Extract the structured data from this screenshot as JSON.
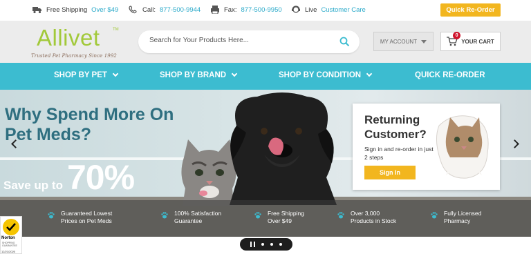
{
  "topbar": {
    "shipping_prefix": "Free Shipping",
    "shipping_value": "Over $49",
    "call_prefix": "Call:",
    "call_value": "877-500-9944",
    "fax_prefix": "Fax:",
    "fax_value": "877-500-9950",
    "live_prefix": "Live",
    "live_value": "Customer Care",
    "reorder_label": "Quick Re-Order"
  },
  "header": {
    "logo_text": "Allivet",
    "logo_tm": "TM",
    "logo_tagline": "Trusted Pet Pharmacy Since 1992",
    "search_placeholder": "Search for Your Products Here...",
    "account_label": "MY ACCOUNT",
    "cart_label": "YOUR CART",
    "cart_count": "0"
  },
  "nav": {
    "items": [
      {
        "label": "SHOP BY PET"
      },
      {
        "label": "SHOP BY BRAND"
      },
      {
        "label": "SHOP BY CONDITION"
      },
      {
        "label": "QUICK RE-ORDER"
      }
    ]
  },
  "hero": {
    "title": "Why Spend More On Pet Meds?",
    "save_label": "Save up to",
    "save_value": "70%",
    "card": {
      "title": "Returning Customer?",
      "subtitle": "Sign in and re-order in just 2 steps",
      "button": "Sign In"
    },
    "features": [
      {
        "text": "Guaranteed Lowest Prices on Pet Meds"
      },
      {
        "text": "100% Satisfaction Guarantee"
      },
      {
        "text": "Free Shipping Over $49"
      },
      {
        "text": "Over 3,000 Products in Stock"
      },
      {
        "text": "Fully Licensed Pharmacy"
      }
    ]
  },
  "norton": {
    "word": "Norton",
    "sub": "SHOPPING GUARANTEE",
    "date": "12/21/2020"
  },
  "colors": {
    "teal": "#3cbcd0",
    "accent_text": "#29a9c9",
    "gold": "#f2b61f",
    "logo_green": "#a2c93a",
    "hero_title": "#2f6f80"
  }
}
